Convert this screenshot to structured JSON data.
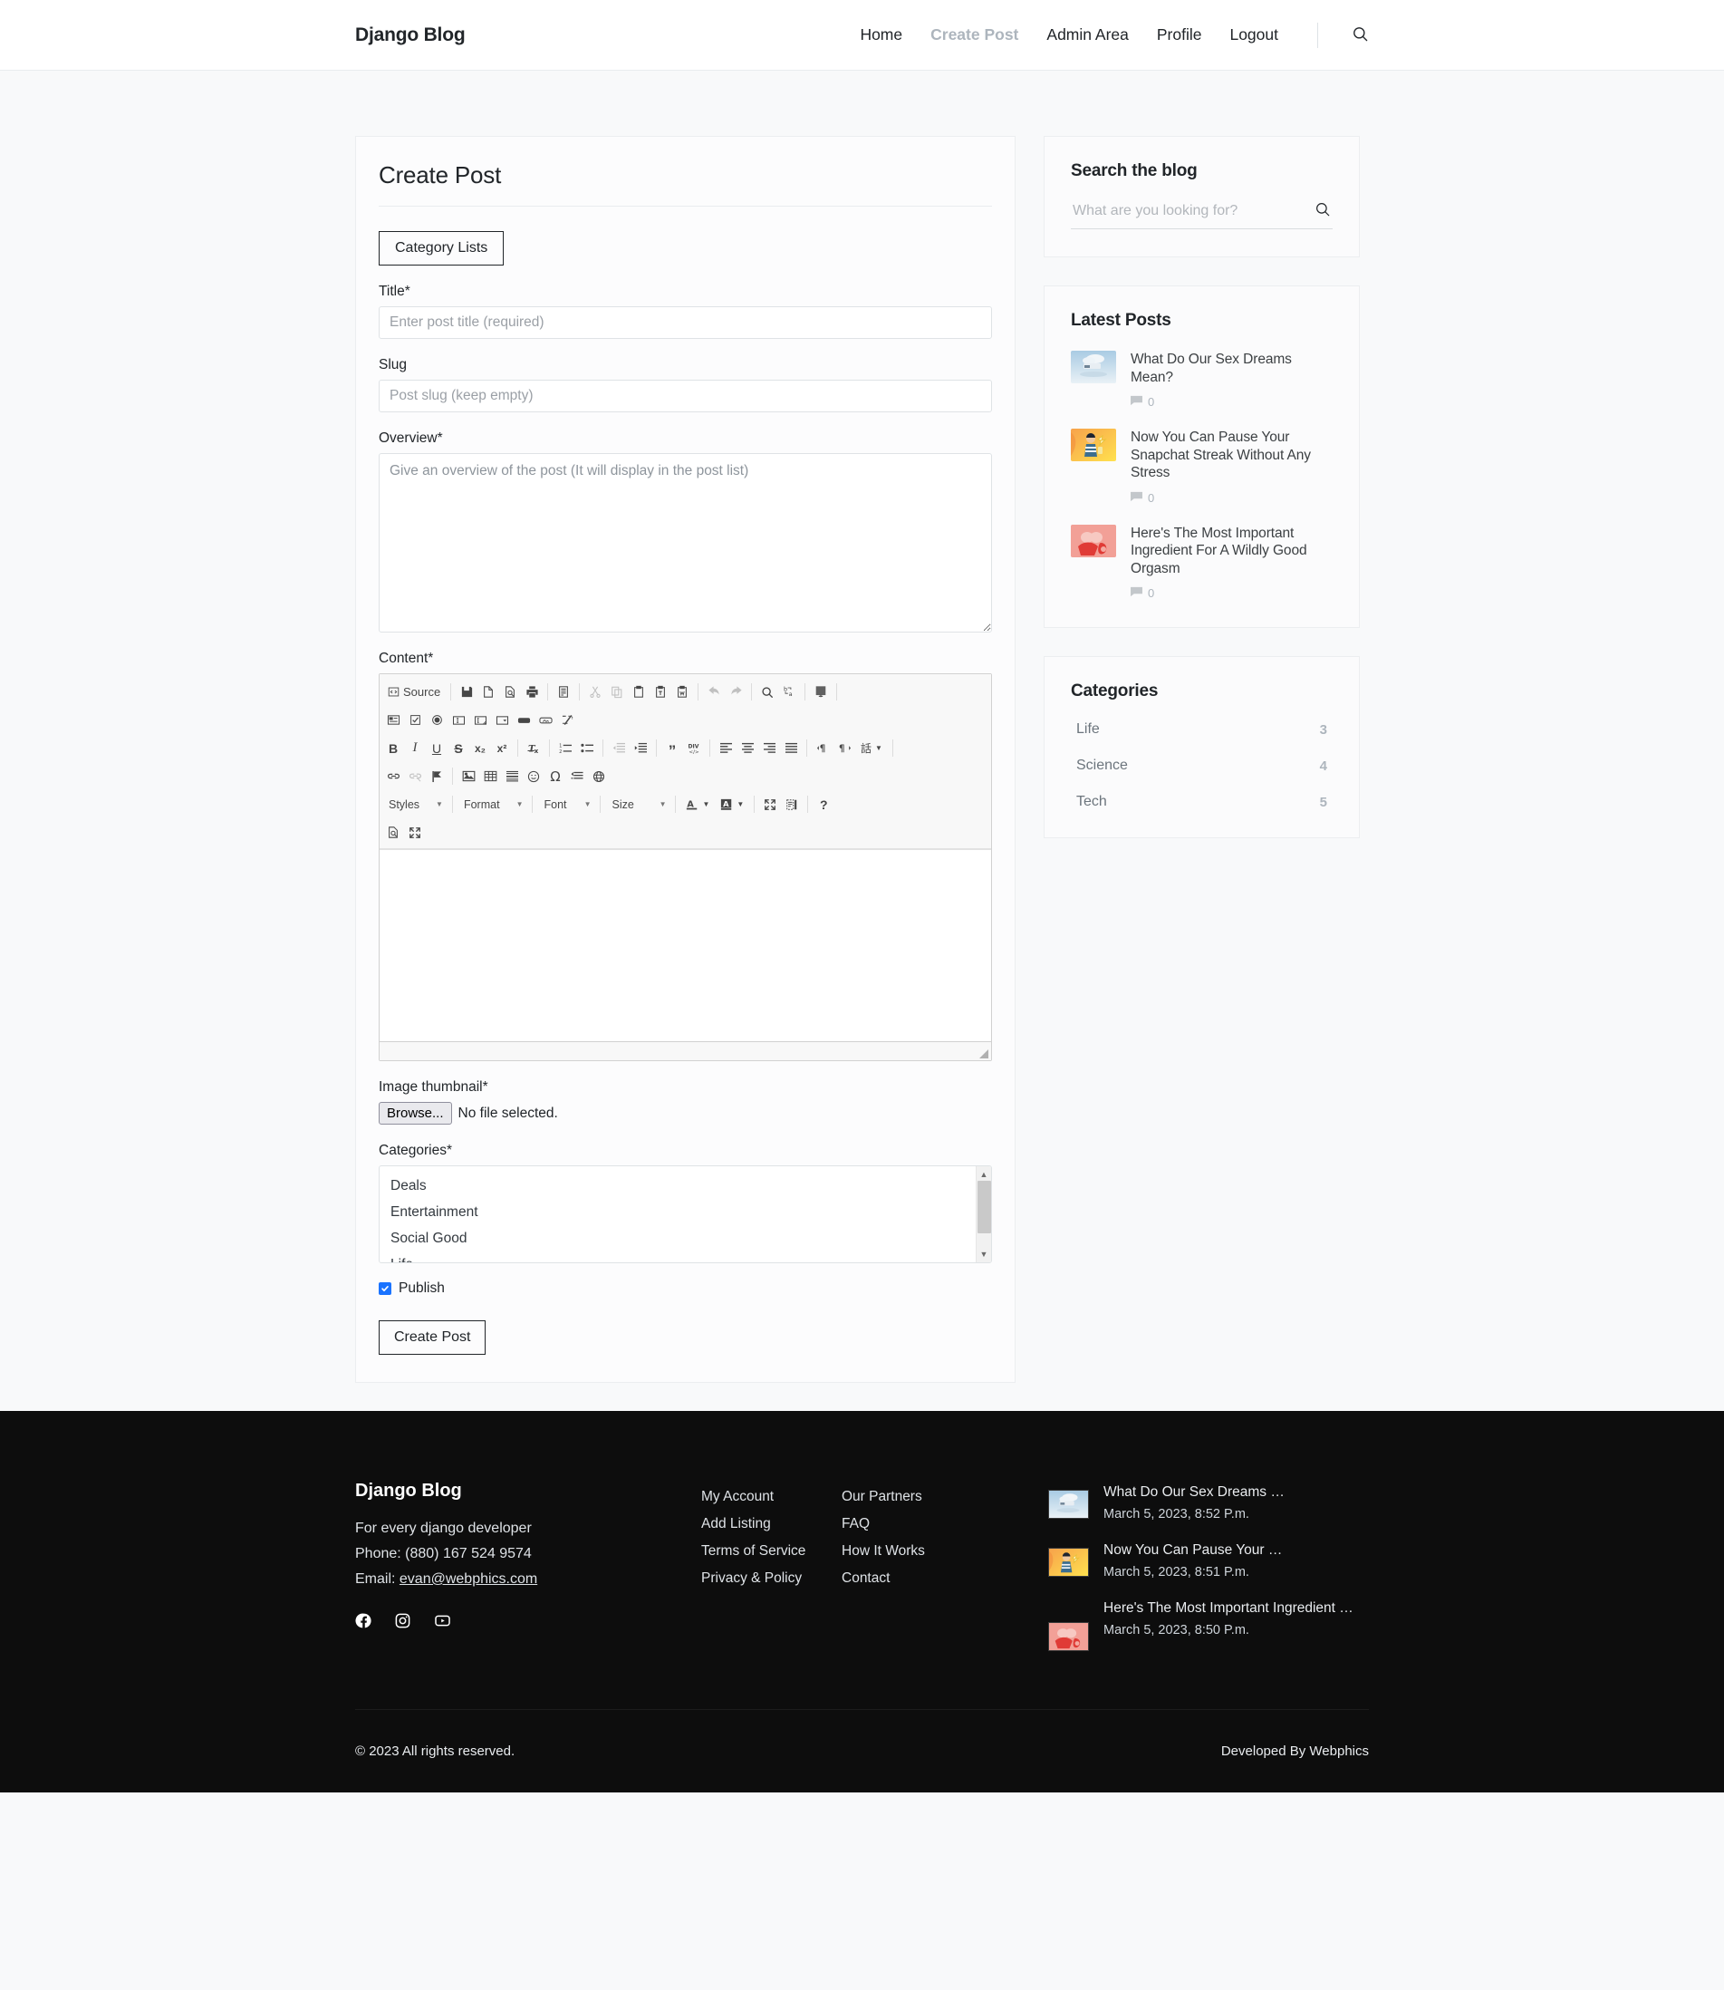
{
  "navbar": {
    "brand": "Django Blog",
    "links": [
      {
        "label": "Home",
        "active": false
      },
      {
        "label": "Create Post",
        "active": true
      },
      {
        "label": "Admin Area",
        "active": false
      },
      {
        "label": "Profile",
        "active": false
      },
      {
        "label": "Logout",
        "active": false
      }
    ],
    "search_icon": "search-icon"
  },
  "form": {
    "title": "Create Post",
    "category_lists_button": "Category Lists",
    "fields": {
      "title_label": "Title*",
      "title_placeholder": "Enter post title (required)",
      "title_value": "",
      "slug_label": "Slug",
      "slug_placeholder": "Post slug (keep empty)",
      "slug_value": "",
      "overview_label": "Overview*",
      "overview_placeholder": "Give an overview of the post (It will display in the post list)",
      "overview_value": "",
      "content_label": "Content*",
      "content_value": "",
      "image_label": "Image thumbnail*",
      "image_button": "Browse...",
      "image_status": "No file selected.",
      "categories_label": "Categories*",
      "publish_label": "Publish",
      "publish_checked": true,
      "submit_label": "Create Post"
    },
    "category_options": [
      "Deals",
      "Entertainment",
      "Social Good",
      "Life"
    ]
  },
  "editor": {
    "source_label": "Source",
    "row1": [
      {
        "name": "source-button",
        "label": "Source",
        "dim": false
      },
      {
        "name": "separator",
        "label": "",
        "dim": false
      },
      {
        "name": "save-icon",
        "label": "",
        "dim": false
      },
      {
        "name": "new-page-icon",
        "label": "",
        "dim": false
      },
      {
        "name": "preview-icon",
        "label": "",
        "dim": false
      },
      {
        "name": "print-icon",
        "label": "",
        "dim": false
      },
      {
        "name": "separator",
        "label": "",
        "dim": false
      },
      {
        "name": "templates-icon",
        "label": "",
        "dim": false
      },
      {
        "name": "separator",
        "label": "",
        "dim": false
      },
      {
        "name": "cut-icon",
        "label": "",
        "dim": true
      },
      {
        "name": "copy-icon",
        "label": "",
        "dim": true
      },
      {
        "name": "paste-icon",
        "label": "",
        "dim": false
      },
      {
        "name": "paste-text-icon",
        "label": "",
        "dim": false
      },
      {
        "name": "paste-word-icon",
        "label": "",
        "dim": false
      },
      {
        "name": "separator",
        "label": "",
        "dim": false
      },
      {
        "name": "undo-icon",
        "label": "",
        "dim": true
      },
      {
        "name": "redo-icon",
        "label": "",
        "dim": true
      },
      {
        "name": "separator",
        "label": "",
        "dim": false
      },
      {
        "name": "find-icon",
        "label": "",
        "dim": false
      },
      {
        "name": "replace-icon",
        "label": "",
        "dim": false
      },
      {
        "name": "separator",
        "label": "",
        "dim": false
      },
      {
        "name": "select-all-icon",
        "label": "",
        "dim": false
      },
      {
        "name": "separator",
        "label": "",
        "dim": false
      }
    ],
    "row2": [
      {
        "name": "form-icon",
        "label": "",
        "dim": false
      },
      {
        "name": "checkbox-icon",
        "label": "",
        "dim": false
      },
      {
        "name": "radio-button-icon",
        "label": "",
        "dim": false
      },
      {
        "name": "text-field-icon",
        "label": "",
        "dim": false
      },
      {
        "name": "textarea-icon",
        "label": "",
        "dim": false
      },
      {
        "name": "select-field-icon",
        "label": "",
        "dim": false
      },
      {
        "name": "button-icon",
        "label": "",
        "dim": false
      },
      {
        "name": "image-button-icon",
        "label": "",
        "dim": false
      },
      {
        "name": "hidden-field-icon",
        "label": "",
        "dim": false
      }
    ],
    "row3": [
      {
        "name": "bold-icon",
        "label": "B",
        "dim": false
      },
      {
        "name": "italic-icon",
        "label": "I",
        "dim": false
      },
      {
        "name": "underline-icon",
        "label": "U",
        "dim": false
      },
      {
        "name": "strikethrough-icon",
        "label": "S",
        "dim": false
      },
      {
        "name": "subscript-icon",
        "label": "x₂",
        "dim": false
      },
      {
        "name": "superscript-icon",
        "label": "x²",
        "dim": false
      },
      {
        "name": "separator",
        "label": "",
        "dim": false
      },
      {
        "name": "remove-format-icon",
        "label": "",
        "dim": false
      },
      {
        "name": "separator",
        "label": "",
        "dim": false
      },
      {
        "name": "numbered-list-icon",
        "label": "",
        "dim": false
      },
      {
        "name": "bulleted-list-icon",
        "label": "",
        "dim": false
      },
      {
        "name": "separator",
        "label": "",
        "dim": false
      },
      {
        "name": "decrease-indent-icon",
        "label": "",
        "dim": true
      },
      {
        "name": "increase-indent-icon",
        "label": "",
        "dim": false
      },
      {
        "name": "separator",
        "label": "",
        "dim": false
      },
      {
        "name": "blockquote-icon",
        "label": "",
        "dim": false
      },
      {
        "name": "create-div-icon",
        "label": "",
        "dim": false
      },
      {
        "name": "separator",
        "label": "",
        "dim": false
      },
      {
        "name": "align-left-icon",
        "label": "",
        "dim": false
      },
      {
        "name": "align-center-icon",
        "label": "",
        "dim": false
      },
      {
        "name": "align-right-icon",
        "label": "",
        "dim": false
      },
      {
        "name": "align-justify-icon",
        "label": "",
        "dim": false
      },
      {
        "name": "separator",
        "label": "",
        "dim": false
      },
      {
        "name": "text-direction-ltr-icon",
        "label": "",
        "dim": false
      },
      {
        "name": "text-direction-rtl-icon",
        "label": "",
        "dim": false
      },
      {
        "name": "language-icon",
        "label": "話",
        "dim": false
      },
      {
        "name": "separator",
        "label": "",
        "dim": false
      }
    ],
    "row4": [
      {
        "name": "link-icon",
        "label": "",
        "dim": false
      },
      {
        "name": "unlink-icon",
        "label": "",
        "dim": true
      },
      {
        "name": "anchor-icon",
        "label": "",
        "dim": false
      },
      {
        "name": "separator",
        "label": "",
        "dim": false
      },
      {
        "name": "image-icon",
        "label": "",
        "dim": false
      },
      {
        "name": "table-icon",
        "label": "",
        "dim": false
      },
      {
        "name": "horizontal-rule-icon",
        "label": "",
        "dim": false
      },
      {
        "name": "smiley-icon",
        "label": "",
        "dim": false
      },
      {
        "name": "special-character-icon",
        "label": "Ω",
        "dim": false
      },
      {
        "name": "page-break-icon",
        "label": "",
        "dim": false
      },
      {
        "name": "iframe-icon",
        "label": "",
        "dim": false
      }
    ],
    "combos": [
      {
        "name": "styles-combo",
        "label": "Styles"
      },
      {
        "name": "format-combo",
        "label": "Format"
      },
      {
        "name": "font-combo",
        "label": "Font"
      },
      {
        "name": "size-combo",
        "label": "Size"
      }
    ],
    "row5_right": [
      {
        "name": "text-color-icon",
        "label": "A",
        "dim": false
      },
      {
        "name": "background-color-icon",
        "label": "A",
        "dim": false
      },
      {
        "name": "separator",
        "label": "",
        "dim": false
      },
      {
        "name": "maximize-icon",
        "label": "",
        "dim": false
      },
      {
        "name": "show-blocks-icon",
        "label": "",
        "dim": false
      },
      {
        "name": "separator",
        "label": "",
        "dim": false
      },
      {
        "name": "about-icon",
        "label": "?",
        "dim": false
      }
    ],
    "row6": [
      {
        "name": "preview-icon",
        "label": "",
        "dim": false
      },
      {
        "name": "maximize-icon",
        "label": "",
        "dim": false
      }
    ]
  },
  "sidebar": {
    "search_widget": {
      "title": "Search the blog",
      "placeholder": "What are you looking for?",
      "value": "",
      "submit_icon": "search-icon"
    },
    "latest_posts": {
      "title": "Latest Posts",
      "items": [
        {
          "title": "What Do Our Sex Dreams Mean?",
          "comments": "0",
          "thumb": "sky-cloud-bed"
        },
        {
          "title": "Now You Can Pause Your Snapchat Streak Without Any Stress",
          "comments": "0",
          "thumb": "person-phone-yellow"
        },
        {
          "title": "Here's The Most Important Ingredient For A Wildly Good Orgasm",
          "comments": "0",
          "thumb": "pink-couple"
        }
      ]
    },
    "categories": {
      "title": "Categories",
      "items": [
        {
          "name": "Life",
          "count": "3"
        },
        {
          "name": "Science",
          "count": "4"
        },
        {
          "name": "Tech",
          "count": "5"
        }
      ]
    }
  },
  "footer": {
    "brand": "Django Blog",
    "tagline": "For every django developer",
    "phone": "Phone: (880) 167 524 9574",
    "email_label": "Email:",
    "email": "evan@webphics.com",
    "social": [
      {
        "name": "facebook-icon"
      },
      {
        "name": "instagram-icon"
      },
      {
        "name": "youtube-icon"
      }
    ],
    "links_col1": [
      "My Account",
      "Add Listing",
      "Terms of Service",
      "Privacy & Policy"
    ],
    "links_col2": [
      "Our Partners",
      "FAQ",
      "How It Works",
      "Contact"
    ],
    "recent_posts": [
      {
        "title": "What Do Our Sex Dreams …",
        "date": "March 5, 2023, 8:52 P.m.",
        "thumb": "sky-cloud-bed"
      },
      {
        "title": "Now You Can Pause Your …",
        "date": "March 5, 2023, 8:51 P.m.",
        "thumb": "person-phone-yellow"
      },
      {
        "title": "Here's The Most Important Ingredient …",
        "date": "March 5, 2023, 8:50 P.m.",
        "thumb": "pink-couple"
      }
    ],
    "copyright": "© 2023 All rights reserved.",
    "developed_by": "Developed By Webphics"
  }
}
